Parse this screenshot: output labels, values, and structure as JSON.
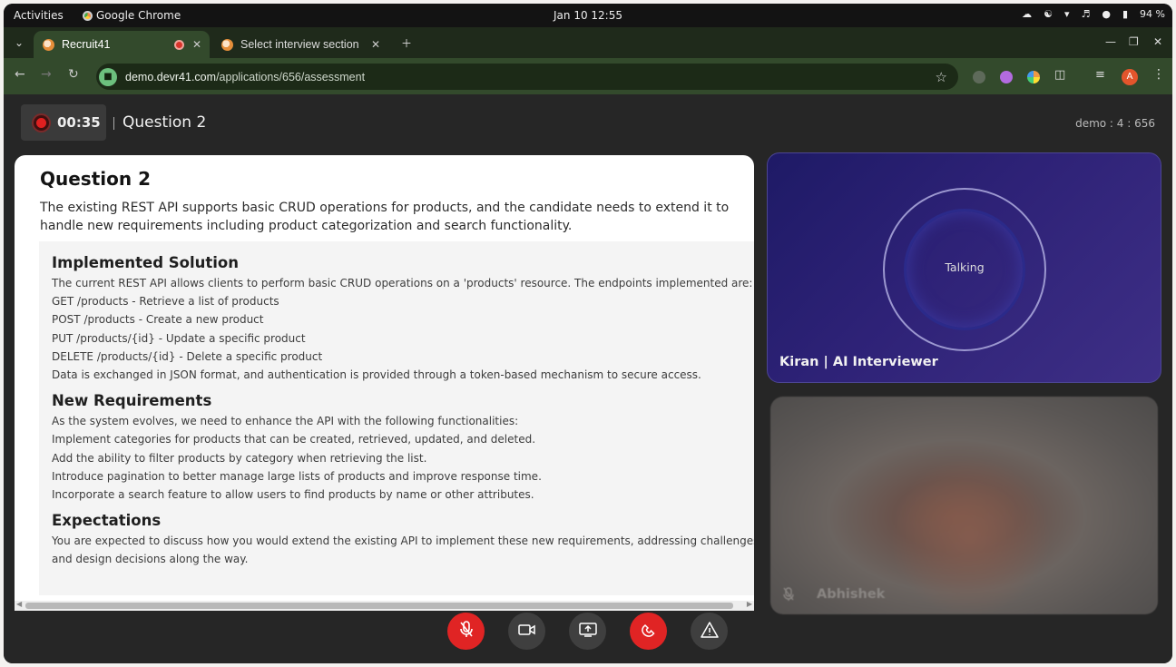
{
  "os_bar": {
    "activities": "Activities",
    "app_name": "Google Chrome",
    "clock": "Jan 10  12:55",
    "battery": "94 %"
  },
  "browser": {
    "tabs": [
      {
        "title": "Recruit41",
        "active": true,
        "recording": true
      },
      {
        "title": "Select interview section",
        "active": false
      }
    ],
    "url_host": "demo.devr41.com",
    "url_path": "/applications/656/assessment",
    "profile_initial": "A"
  },
  "header": {
    "timer": "00:35",
    "question_title": "Question 2",
    "session_id": "demo : 4 : 656"
  },
  "question": {
    "title": "Question 2",
    "description": "The existing REST API supports basic CRUD operations for products, and the candidate needs to extend it to handle new requirements including product categorization and search functionality.",
    "sections": [
      {
        "heading": "Implemented Solution",
        "lines": [
          "The current REST API allows clients to perform basic CRUD operations on a 'products' resource. The endpoints implemented are:",
          "GET /products - Retrieve a list of products",
          "POST /products - Create a new product",
          "PUT /products/{id} - Update a specific product",
          "DELETE /products/{id} - Delete a specific product",
          "Data is exchanged in JSON format, and authentication is provided through a token-based mechanism to secure access."
        ]
      },
      {
        "heading": "New Requirements",
        "lines": [
          "As the system evolves, we need to enhance the API with the following functionalities:",
          "Implement categories for products that can be created, retrieved, updated, and deleted.",
          "Add the ability to filter products by category when retrieving the list.",
          "Introduce pagination to better manage large lists of products and improve response time.",
          "Incorporate a search feature to allow users to find products by name or other attributes."
        ]
      },
      {
        "heading": "Expectations",
        "lines": [
          "You are expected to discuss how you would extend the existing API to implement these new requirements, addressing challenges",
          "and design decisions along the way."
        ]
      }
    ]
  },
  "ai_tile": {
    "status": "Talking",
    "name": "Kiran | AI Interviewer"
  },
  "user_tile": {
    "name": "Abhishek",
    "mic_muted": true
  },
  "controls": [
    {
      "name": "mute-mic-button",
      "icon": "mic-off-icon",
      "style": "red"
    },
    {
      "name": "camera-button",
      "icon": "video-camera-icon",
      "style": "grey"
    },
    {
      "name": "share-screen-button",
      "icon": "screen-share-icon",
      "style": "grey"
    },
    {
      "name": "end-call-button",
      "icon": "phone-hangup-icon",
      "style": "red"
    },
    {
      "name": "report-issue-button",
      "icon": "warning-triangle-icon",
      "style": "grey"
    }
  ],
  "colors": {
    "accent_red": "#e02424",
    "ai_tile_bg": "#2e2277",
    "chrome_frame": "#334a2c"
  }
}
